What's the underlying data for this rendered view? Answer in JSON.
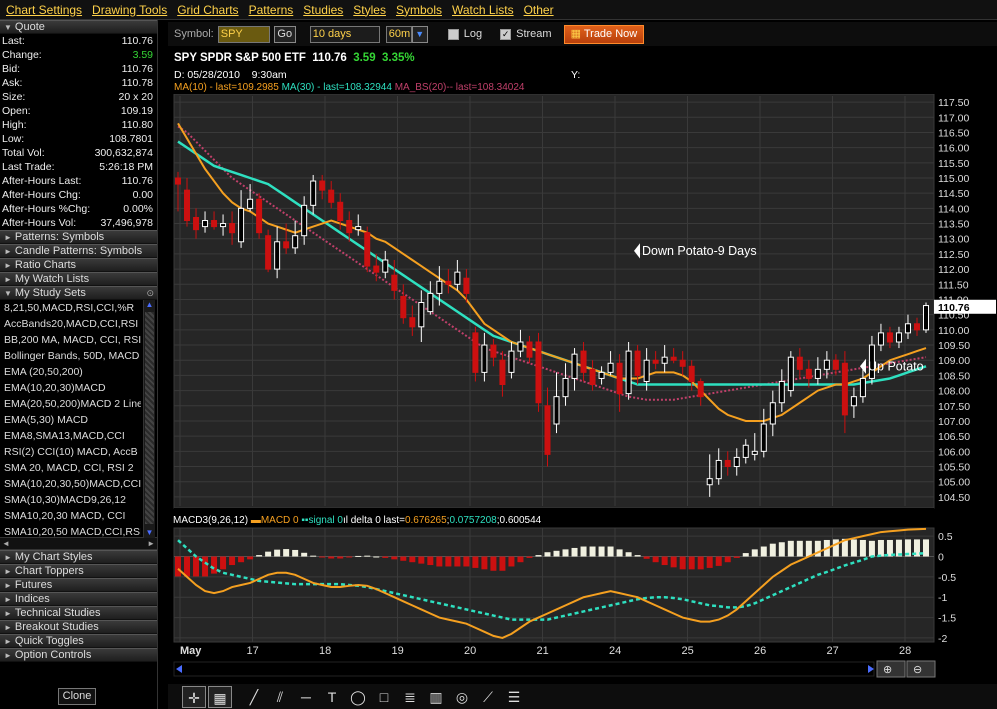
{
  "menu": [
    "Chart Settings",
    "Drawing Tools",
    "Grid Charts",
    "Patterns",
    "Studies",
    "Styles",
    "Symbols",
    "Watch Lists",
    "Other"
  ],
  "quote": {
    "title": "Quote",
    "rows": [
      {
        "label": "Last:",
        "value": "110.76"
      },
      {
        "label": "Change:",
        "value": "3.59",
        "positive": true
      },
      {
        "label": "Bid:",
        "value": "110.76"
      },
      {
        "label": "Ask:",
        "value": "110.78"
      },
      {
        "label": "Size:",
        "value": "20 x 20"
      },
      {
        "label": "Open:",
        "value": "109.19"
      },
      {
        "label": "High:",
        "value": "110.80"
      },
      {
        "label": "Low:",
        "value": "108.7801"
      },
      {
        "label": "Total Vol:",
        "value": "300,632,874"
      },
      {
        "label": "Last Trade:",
        "value": "5:26:18 PM"
      },
      {
        "label": "After-Hours Last:",
        "value": "110.76"
      },
      {
        "label": "After-Hours Chg:",
        "value": "0.00"
      },
      {
        "label": "After-Hours %Chg:",
        "value": "0.00%"
      },
      {
        "label": "After-Hours Vol:",
        "value": "37,496,978"
      }
    ]
  },
  "sections_top": [
    "Patterns: Symbols",
    "Candle Patterns: Symbols",
    "Ratio Charts",
    "My Watch Lists",
    "My Study Sets"
  ],
  "study_sets": [
    "8,21,50,MACD,RSI,CCI,%R",
    "AccBands20,MACD,CCI,RSI",
    "BB,200 MA, MACD, CCI, RSI",
    "Bollinger Bands, 50D, MACD",
    "EMA (20,50,200)",
    "EMA(10,20,30)MACD",
    "EMA(20,50,200)MACD 2 Lines",
    "EMA(5,30) MACD",
    "EMA8,SMA13,MACD,CCI",
    "RSI(2) CCI(10) MACD, AccB",
    "SMA 20, MACD, CCI, RSI 2",
    "SMA(10,20,30,50)MACD,CCI",
    "SMA(10,30)MACD9,26,12",
    "SMA10,20,30 MACD, CCI",
    "SMA10,20,50 MACD,CCI,RSI"
  ],
  "sections_bottom": [
    "My Chart Styles",
    "Chart Toppers",
    "Futures",
    "Indices",
    "Technical Studies",
    "Breakout Studies",
    "Quick Toggles",
    "Option Controls"
  ],
  "clone_label": "Clone",
  "toolbar": {
    "symbol_label": "Symbol:",
    "symbol_value": "SPY",
    "go_label": "Go",
    "period_value": "10 days",
    "interval_value": "60m",
    "log_label": "Log",
    "log_checked": false,
    "stream_label": "Stream",
    "stream_checked": true,
    "trade_now_label": "Trade Now"
  },
  "header": {
    "title": "SPY SPDR S&P 500 ETF",
    "last": "110.76",
    "change": "3.59",
    "pct": "3.35%",
    "date_label": "D: 05/28/2010",
    "time_label": "9:30am",
    "y_label": "Y:",
    "ma10": "MA(10) - last=109.2985",
    "ma30": "MA(30) - last=108.32944",
    "bs": "MA_BS(20)-- last=108.34024",
    "macd_prefix": "MACD3(9,26,12)",
    "macd_line": "MACD 0",
    "macd_signal": "signal 0",
    "macd_delta": "delta 0 last=",
    "macd_v1": "0.676265",
    "macd_v2": "0.0757208",
    "macd_v3": "0.600544"
  },
  "annotations": {
    "down": "Down Potato-9 Days",
    "up": "Up Potato"
  },
  "colors": {
    "ma10": "#f5a020",
    "ma30": "#2ee0c0",
    "bs": "#c0406a",
    "up_candle": "#ffffff",
    "down_candle": "#cc1010",
    "macd": "#f5a020",
    "signal": "#2ee0c0",
    "hist_pos": "#f0f0e0",
    "hist_neg": "#cc1010"
  },
  "chart_data": {
    "type": "candlestick",
    "title": "SPY SPDR S&P 500 ETF",
    "interval": "60m",
    "price_axis": {
      "ticks": [
        117.5,
        117.0,
        116.5,
        116.0,
        115.5,
        115.0,
        114.5,
        114.0,
        113.5,
        113.0,
        112.5,
        112.0,
        111.5,
        111.0,
        110.5,
        110.0,
        109.5,
        109.0,
        108.5,
        108.0,
        107.5,
        107.0,
        106.5,
        106.0,
        105.5,
        105.0,
        104.5
      ],
      "tick_labels": [
        "117.50",
        "117.00",
        "116.50",
        "116.00",
        "115.50",
        "115.00",
        "114.50",
        "114.00",
        "113.50",
        "113.00",
        "112.50",
        "112.00",
        "111.50",
        "111.00",
        "110.50",
        "110.00",
        "109.50",
        "109.00",
        "108.50",
        "108.00",
        "107.50",
        "107.00",
        "106.50",
        "106.00",
        "105.50",
        "105.00",
        "104.50"
      ],
      "last_marker": "110.76",
      "ylim": [
        104.2,
        117.7
      ]
    },
    "x_labels": [
      "May",
      "17",
      "18",
      "19",
      "20",
      "21",
      "24",
      "25",
      "26",
      "27",
      "28"
    ],
    "candles": [
      [
        115.0,
        114.8,
        115.2,
        113.9
      ],
      [
        114.6,
        113.6,
        115.0,
        113.4
      ],
      [
        113.7,
        113.3,
        114.0,
        113.0
      ],
      [
        113.4,
        113.6,
        113.9,
        113.2
      ],
      [
        113.6,
        113.4,
        113.9,
        113.3
      ],
      [
        113.4,
        113.5,
        113.8,
        113.1
      ],
      [
        113.5,
        113.2,
        113.9,
        112.8
      ],
      [
        112.9,
        114.0,
        114.6,
        112.7
      ],
      [
        114.0,
        114.3,
        114.8,
        113.9
      ],
      [
        114.3,
        113.2,
        114.5,
        113.0
      ],
      [
        113.1,
        112.0,
        113.3,
        111.9
      ],
      [
        112.0,
        112.9,
        113.4,
        111.7
      ],
      [
        112.9,
        112.7,
        113.5,
        112.5
      ],
      [
        112.7,
        113.1,
        113.6,
        112.5
      ],
      [
        113.1,
        114.1,
        114.4,
        112.8
      ],
      [
        114.1,
        114.9,
        115.1,
        113.8
      ],
      [
        114.9,
        114.6,
        115.1,
        114.3
      ],
      [
        114.6,
        114.2,
        114.9,
        114.0
      ],
      [
        114.2,
        113.6,
        114.5,
        113.3
      ],
      [
        113.6,
        113.2,
        113.9,
        112.9
      ],
      [
        113.3,
        113.4,
        113.8,
        113.1
      ],
      [
        113.2,
        112.1,
        113.4,
        111.9
      ],
      [
        112.1,
        111.9,
        112.5,
        111.6
      ],
      [
        111.9,
        112.3,
        112.6,
        111.7
      ],
      [
        111.8,
        111.3,
        112.3,
        111.0
      ],
      [
        111.1,
        110.4,
        111.5,
        110.2
      ],
      [
        110.4,
        110.1,
        110.8,
        109.8
      ],
      [
        110.1,
        110.9,
        111.3,
        109.6
      ],
      [
        110.6,
        111.2,
        111.6,
        110.5
      ],
      [
        111.2,
        111.6,
        112.1,
        110.8
      ],
      [
        111.6,
        111.5,
        112.0,
        111.2
      ],
      [
        111.5,
        111.9,
        112.3,
        111.3
      ],
      [
        111.7,
        111.2,
        112.0,
        110.9
      ],
      [
        109.9,
        108.6,
        110.1,
        108.3
      ],
      [
        108.6,
        109.5,
        109.9,
        108.3
      ],
      [
        109.5,
        109.1,
        109.7,
        108.8
      ],
      [
        109.0,
        108.2,
        109.3,
        107.8
      ],
      [
        108.6,
        109.3,
        109.6,
        108.4
      ],
      [
        109.3,
        109.6,
        110.0,
        109.1
      ],
      [
        109.6,
        109.1,
        109.8,
        108.9
      ],
      [
        109.6,
        107.6,
        109.9,
        107.3
      ],
      [
        107.5,
        105.9,
        108.1,
        105.5
      ],
      [
        106.9,
        107.8,
        108.6,
        106.6
      ],
      [
        107.8,
        108.4,
        108.9,
        107.5
      ],
      [
        108.4,
        109.2,
        109.4,
        108.0
      ],
      [
        109.3,
        108.6,
        109.6,
        108.3
      ],
      [
        108.7,
        108.2,
        109.0,
        108.0
      ],
      [
        108.4,
        108.6,
        108.8,
        108.2
      ],
      [
        108.6,
        108.9,
        109.3,
        108.5
      ],
      [
        108.9,
        107.9,
        109.2,
        107.3
      ],
      [
        107.9,
        109.3,
        109.6,
        107.7
      ],
      [
        109.3,
        108.5,
        109.5,
        108.2
      ],
      [
        108.3,
        109.0,
        109.4,
        108.0
      ],
      [
        109.0,
        108.9,
        109.3,
        108.7
      ],
      [
        108.9,
        109.1,
        109.5,
        108.6
      ],
      [
        109.1,
        109.0,
        109.4,
        108.9
      ],
      [
        109.0,
        108.8,
        109.3,
        108.5
      ],
      [
        108.8,
        108.3,
        109.0,
        108.0
      ],
      [
        108.3,
        107.8,
        108.4,
        107.5
      ],
      [
        104.9,
        105.1,
        105.9,
        104.5
      ],
      [
        105.1,
        105.7,
        106.1,
        104.9
      ],
      [
        105.7,
        105.5,
        106.0,
        105.2
      ],
      [
        105.5,
        105.8,
        106.1,
        105.2
      ],
      [
        105.8,
        106.2,
        106.4,
        105.6
      ],
      [
        105.9,
        106.0,
        106.6,
        105.7
      ],
      [
        106.0,
        106.9,
        107.4,
        105.8
      ],
      [
        106.9,
        107.6,
        108.0,
        106.5
      ],
      [
        107.6,
        108.3,
        108.7,
        107.3
      ],
      [
        108.0,
        109.1,
        109.3,
        107.8
      ],
      [
        109.1,
        108.7,
        109.4,
        108.4
      ],
      [
        108.7,
        108.4,
        109.0,
        108.1
      ],
      [
        108.4,
        108.7,
        109.1,
        108.2
      ],
      [
        108.7,
        109.0,
        109.3,
        108.4
      ],
      [
        109.0,
        108.7,
        109.2,
        108.5
      ],
      [
        108.9,
        107.2,
        109.3,
        106.6
      ],
      [
        107.5,
        107.8,
        108.1,
        107.1
      ],
      [
        107.8,
        108.4,
        108.7,
        107.6
      ],
      [
        108.4,
        109.5,
        109.8,
        108.2
      ],
      [
        109.5,
        109.9,
        110.2,
        109.3
      ],
      [
        109.9,
        109.6,
        110.1,
        109.4
      ],
      [
        109.6,
        109.9,
        110.1,
        109.4
      ],
      [
        109.9,
        110.2,
        110.5,
        109.7
      ],
      [
        110.2,
        110.0,
        110.4,
        109.8
      ],
      [
        110.0,
        110.8,
        110.9,
        109.9
      ]
    ],
    "ma10": [
      116.8,
      116.3,
      115.8,
      115.3,
      114.9,
      114.5,
      114.2,
      114.0,
      113.9,
      113.7,
      113.5,
      113.4,
      113.3,
      113.2,
      113.3,
      113.4,
      113.5,
      113.6,
      113.5,
      113.4,
      113.3,
      113.2,
      113.0,
      112.9,
      112.7,
      112.5,
      112.3,
      112.1,
      111.9,
      111.7,
      111.5,
      111.3,
      111.0,
      110.6,
      110.2,
      110.0,
      109.8,
      109.6,
      109.5,
      109.4,
      109.3,
      109.2,
      109.1,
      109.0,
      108.9,
      108.8,
      108.7,
      108.6,
      108.5,
      108.4,
      108.4,
      108.4,
      108.5,
      108.6,
      108.6,
      108.6,
      108.5,
      108.3,
      108.0,
      107.7,
      107.4,
      107.2,
      107.1,
      107.0,
      107.0,
      107.0,
      107.1,
      107.2,
      107.4,
      107.6,
      107.8,
      108.0,
      108.1,
      108.2,
      108.2,
      108.3,
      108.4,
      108.6,
      108.8,
      109.0,
      109.1,
      109.2,
      109.3,
      109.4
    ],
    "ma30": [
      116.2,
      116.0,
      115.8,
      115.6,
      115.4,
      115.3,
      115.2,
      115.1,
      115.0,
      114.9,
      114.8,
      114.6,
      114.4,
      114.2,
      114.0,
      113.8,
      113.6,
      113.4,
      113.2,
      113.0,
      112.8,
      112.6,
      112.4,
      112.2,
      112.0,
      111.8,
      111.6,
      111.4,
      111.2,
      111.0,
      110.8,
      110.6,
      110.4,
      110.2,
      110.0,
      109.8,
      109.7,
      109.6,
      109.5,
      109.4,
      109.3,
      109.2,
      109.1,
      109.0,
      108.9,
      108.8,
      108.7,
      108.6,
      108.5,
      108.4,
      108.3,
      108.2,
      108.2,
      108.2,
      108.2,
      108.2,
      108.2,
      108.2,
      108.2,
      108.2,
      108.2,
      108.2,
      108.2,
      108.2,
      108.2,
      108.2,
      108.2,
      108.2,
      108.2,
      108.2,
      108.2,
      108.2,
      108.2,
      108.2,
      108.2,
      108.2,
      108.25,
      108.3,
      108.35,
      108.4,
      108.5,
      108.6,
      108.7,
      108.8
    ],
    "ma_bs": [
      116.7,
      116.5,
      116.2,
      115.9,
      115.6,
      115.3,
      115.0,
      114.8,
      114.6,
      114.4,
      114.2,
      114.0,
      113.8,
      113.6,
      113.4,
      113.2,
      113.0,
      112.8,
      112.6,
      112.4,
      112.2,
      112.0,
      111.8,
      111.6,
      111.4,
      111.2,
      111.0,
      110.8,
      110.6,
      110.4,
      110.2,
      110.0,
      109.8,
      109.6,
      109.4,
      109.3,
      109.2,
      109.1,
      109.0,
      108.9,
      108.8,
      108.7,
      108.6,
      108.5,
      108.4,
      108.3,
      108.2,
      108.1,
      108.0,
      107.9,
      107.8,
      107.75,
      107.7,
      107.7,
      107.7,
      107.7,
      107.75,
      107.8,
      107.85,
      107.9,
      107.95,
      108.0,
      108.05,
      108.1,
      108.15,
      108.2,
      108.25,
      108.3,
      108.35,
      108.4,
      108.45,
      108.5,
      108.55,
      108.6,
      108.65,
      108.7,
      108.75,
      108.8,
      108.85,
      108.9,
      108.95,
      109.0,
      109.05,
      109.1
    ],
    "macd_axis": {
      "ticks": [
        0.5,
        0,
        -0.5,
        -1,
        -1.5,
        -2
      ],
      "tick_labels": [
        "0.5",
        "0",
        "-0.5",
        "-1",
        "-1.5",
        "-2"
      ],
      "ylim": [
        -2.1,
        0.7
      ]
    },
    "macd": [
      -0.3,
      -0.5,
      -0.7,
      -0.85,
      -0.9,
      -0.85,
      -0.75,
      -0.7,
      -0.65,
      -0.55,
      -0.45,
      -0.4,
      -0.4,
      -0.45,
      -0.55,
      -0.65,
      -0.7,
      -0.75,
      -0.75,
      -0.72,
      -0.7,
      -0.72,
      -0.8,
      -0.9,
      -1.0,
      -1.1,
      -1.2,
      -1.3,
      -1.4,
      -1.5,
      -1.55,
      -1.6,
      -1.65,
      -1.75,
      -1.85,
      -1.95,
      -2.0,
      -1.9,
      -1.75,
      -1.6,
      -1.5,
      -1.4,
      -1.3,
      -1.2,
      -1.1,
      -1.0,
      -0.95,
      -0.9,
      -0.85,
      -0.9,
      -0.95,
      -1.0,
      -1.1,
      -1.2,
      -1.3,
      -1.4,
      -1.5,
      -1.55,
      -1.6,
      -1.6,
      -1.55,
      -1.45,
      -1.3,
      -1.1,
      -0.9,
      -0.7,
      -0.5,
      -0.35,
      -0.2,
      -0.1,
      0.0,
      0.1,
      0.2,
      0.3,
      0.4,
      0.45,
      0.5,
      0.55,
      0.6,
      0.62,
      0.64,
      0.66,
      0.67,
      0.68
    ],
    "macd_signal": [
      0.4,
      0.2,
      0.0,
      -0.15,
      -0.3,
      -0.4,
      -0.45,
      -0.5,
      -0.55,
      -0.6,
      -0.62,
      -0.64,
      -0.66,
      -0.68,
      -0.68,
      -0.68,
      -0.68,
      -0.68,
      -0.68,
      -0.7,
      -0.72,
      -0.75,
      -0.8,
      -0.85,
      -0.9,
      -0.95,
      -1.0,
      -1.05,
      -1.1,
      -1.15,
      -1.2,
      -1.25,
      -1.3,
      -1.35,
      -1.4,
      -1.45,
      -1.5,
      -1.55,
      -1.55,
      -1.55,
      -1.55,
      -1.55,
      -1.5,
      -1.45,
      -1.4,
      -1.35,
      -1.3,
      -1.25,
      -1.2,
      -1.15,
      -1.1,
      -1.05,
      -1.02,
      -1.0,
      -1.0,
      -1.02,
      -1.05,
      -1.1,
      -1.15,
      -1.2,
      -1.22,
      -1.25,
      -1.25,
      -1.22,
      -1.15,
      -1.05,
      -0.95,
      -0.85,
      -0.75,
      -0.65,
      -0.55,
      -0.45,
      -0.38,
      -0.3,
      -0.22,
      -0.15,
      -0.08,
      0.0,
      0.02,
      0.04,
      0.05,
      0.06,
      0.07,
      0.08
    ]
  }
}
